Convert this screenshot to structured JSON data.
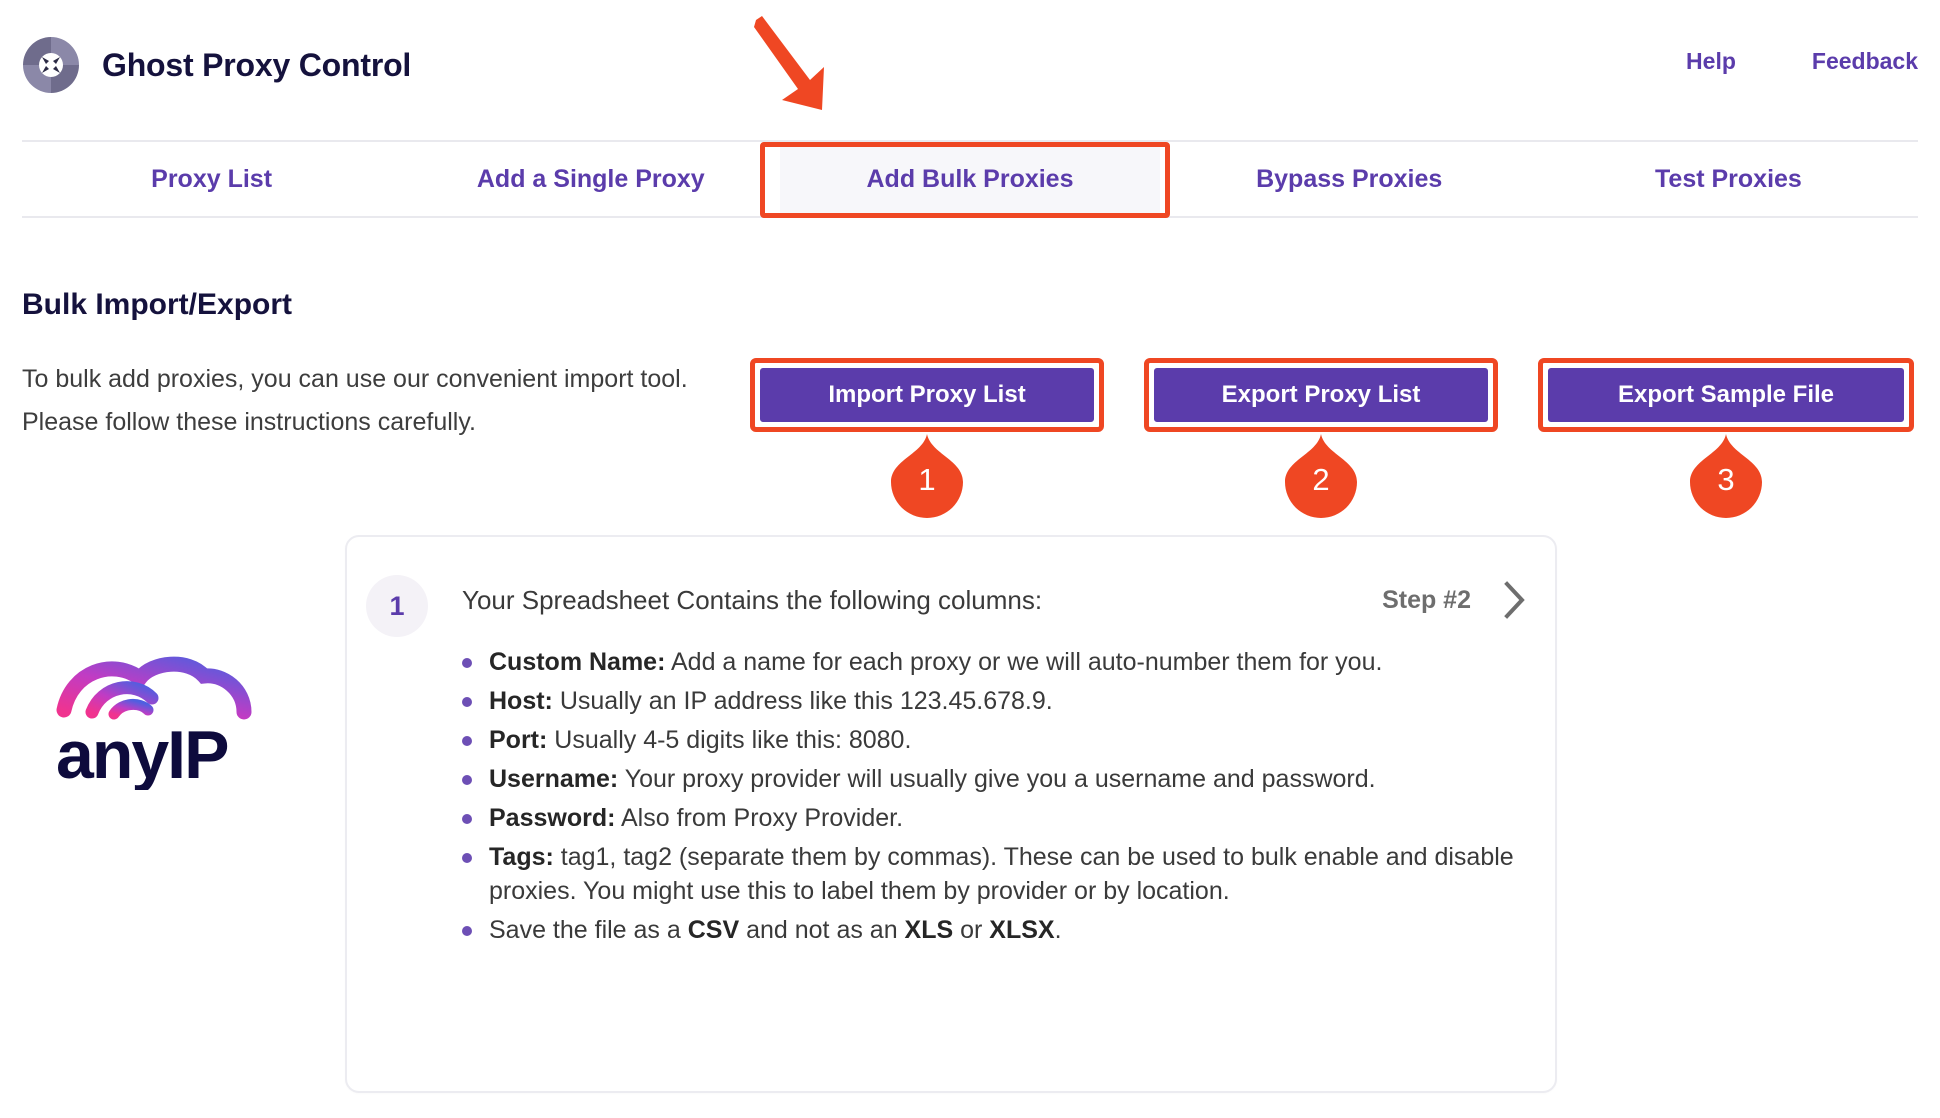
{
  "header": {
    "logo_icon": "ghost-proxy-target-icon",
    "title": "Ghost Proxy Control",
    "links": [
      {
        "label": "Help",
        "name": "help"
      },
      {
        "label": "Feedback",
        "name": "feedback"
      }
    ]
  },
  "tabs": [
    {
      "label": "Proxy List",
      "active": false
    },
    {
      "label": "Add a Single Proxy",
      "active": false
    },
    {
      "label": "Add Bulk Proxies",
      "active": true
    },
    {
      "label": "Bypass Proxies",
      "active": false
    },
    {
      "label": "Test Proxies",
      "active": false
    }
  ],
  "main": {
    "page_title": "Bulk Import/Export",
    "page_description": "To bulk add proxies, you can use our convenient import tool. Please follow these instructions carefully.",
    "actions": [
      {
        "label": "Import Proxy List",
        "marker": "1"
      },
      {
        "label": "Export Proxy List",
        "marker": "2"
      },
      {
        "label": "Export Sample File",
        "marker": "3"
      }
    ]
  },
  "card": {
    "step_number": "1",
    "step_title": "Your Spreadsheet Contains the following columns:",
    "next_step_label": "Step #2",
    "next_step_icon": "chevron-right-icon",
    "bullets": [
      {
        "term": "Custom Name:",
        "text": " Add a name for each proxy or we will auto-number them for you."
      },
      {
        "term": "Host:",
        "text": " Usually an IP address like this 123.45.678.9."
      },
      {
        "term": "Port:",
        "text": " Usually 4-5 digits like this: 8080."
      },
      {
        "term": "Username:",
        "text": " Your proxy provider will usually give you a username and password."
      },
      {
        "term": "Password:",
        "text": " Also from Proxy Provider."
      },
      {
        "term": "Tags:",
        "text": " tag1, tag2 (separate them by commas). These can be used to bulk enable and disable proxies. You might use this to label them by provider or by location."
      },
      {
        "term": "",
        "text": "Save the file as a CSV and not as an XLS or XLSX.",
        "bold_words": [
          "CSV",
          "XLS",
          "XLSX"
        ]
      }
    ]
  },
  "sidebar_logo": {
    "name": "anyip-logo",
    "text": "anyIP"
  },
  "annotations": {
    "arrow_icon": "down-right-arrow-annotation",
    "tab_highlight_color": "#ef4723",
    "button_highlight_color": "#ef4723"
  },
  "colors": {
    "brand_purple": "#5b3cab",
    "brand_navy": "#15123d",
    "annotation_orange": "#ef4723",
    "bullet_purple": "#6d4fb5",
    "text_gray": "#3a3a3a"
  }
}
